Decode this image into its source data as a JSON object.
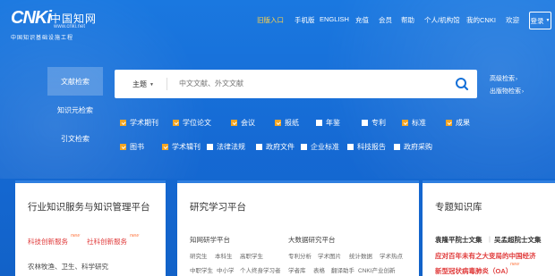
{
  "brand": {
    "mark": "CNKi",
    "name": "中国知网",
    "url": "www.cnki.net",
    "sub": "中国知识基础设施工程"
  },
  "nav": [
    "旧版入口",
    "手机版",
    "ENGLISH",
    "充值",
    "会员",
    "帮助",
    "个人/机构馆",
    "我的CNKI",
    "欢迎"
  ],
  "login": "登录",
  "colors": {
    "highlight": "#ffd24a",
    "accent": "#f5a623",
    "primary": "#1570d8"
  },
  "side_tabs": [
    "文献检索",
    "知识元检索",
    "引文检索"
  ],
  "search": {
    "scope": "主题",
    "placeholder": "中文文献、外文文献"
  },
  "adv": [
    "高级检索",
    "出版物检索"
  ],
  "checks_row1": [
    {
      "label": "学术期刊",
      "on": true
    },
    {
      "label": "学位论文",
      "on": true
    },
    {
      "label": "会议",
      "on": true
    },
    {
      "label": "报纸",
      "on": true
    },
    {
      "label": "年鉴",
      "on": false
    },
    {
      "label": "专利",
      "on": false
    },
    {
      "label": "标准",
      "on": true
    },
    {
      "label": "成果",
      "on": true
    }
  ],
  "checks_row2": [
    {
      "label": "图书",
      "on": true
    },
    {
      "label": "学术辑刊",
      "on": true
    },
    {
      "label": "法律法规",
      "on": false
    },
    {
      "label": "政府文件",
      "on": false
    },
    {
      "label": "企业标准",
      "on": false
    },
    {
      "label": "科技报告",
      "on": false
    },
    {
      "label": "政府采购",
      "on": false
    }
  ],
  "card1": {
    "title": "行业知识服务与知识管理平台",
    "links": [
      "科技创新服务",
      "社科创新服务"
    ],
    "more": "农林牧渔、卫生、科学研究"
  },
  "card2": {
    "title": "研究学习平台",
    "col1": "知网研学平台",
    "col2": "大数据研究平台",
    "row1": [
      "研究生",
      "本科生",
      "高职学生"
    ],
    "row2": [
      "中职学生",
      "中小学",
      "个人终身学习者"
    ],
    "row3": [
      "专利分析",
      "学术图片",
      "统计数据",
      "学术热点"
    ],
    "row4": [
      "学者库",
      "表格",
      "翻译助手",
      "CNKI产业创新"
    ]
  },
  "card3": {
    "title": "专题知识库",
    "line1": "袁隆平院士文集",
    "line1b": "吴孟超院士文集",
    "line2": "应对百年未有之大变局的中国经济",
    "line3": "新型冠状病毒肺炎（OA）"
  },
  "new_tag": "new"
}
